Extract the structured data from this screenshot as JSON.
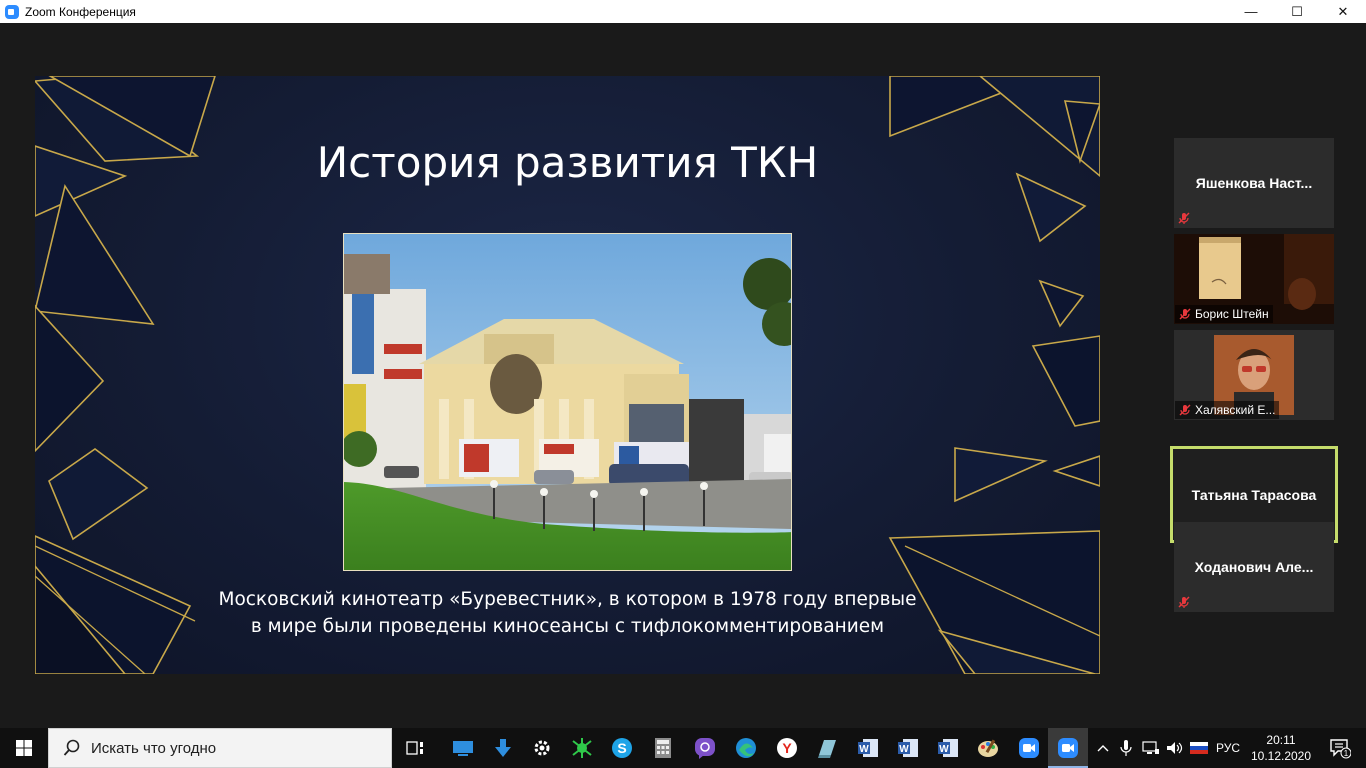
{
  "window": {
    "title": "Zoom Конференция",
    "controls": {
      "minimize": "—",
      "maximize": "☐",
      "close": "✕"
    }
  },
  "slide": {
    "title": "История развития ТКН",
    "caption_line1": "Московский кинотеатр «Буревестник», в котором в 1978 году впервые",
    "caption_line2": "в мире были проведены киносеансы с тифлокомментированием"
  },
  "participants": [
    {
      "name": "Яшенкова  Наст...",
      "muted": true,
      "video": false
    },
    {
      "name": "Борис Штейн",
      "muted": true,
      "video": true
    },
    {
      "name": "Халявский Е...",
      "muted": true,
      "video": true
    },
    {
      "name": "Татьяна Тарасова",
      "muted": false,
      "video": false,
      "active_speaker": true
    },
    {
      "name": "Ходанович  Але...",
      "muted": true,
      "video": false
    }
  ],
  "taskbar": {
    "search_placeholder": "Искать что угодно",
    "icons": [
      "task-view-icon",
      "monitor-app-icon",
      "download-icon",
      "settings-icon",
      "spider-icon",
      "skype-icon",
      "calculator-icon",
      "viber-icon",
      "edge-icon",
      "yandex-icon",
      "book-app-icon",
      "word-icon",
      "word-icon",
      "word-icon",
      "paint-icon",
      "zoom-icon",
      "zoom-icon"
    ],
    "language": "РУС",
    "time": "20:11",
    "date": "10.12.2020",
    "notification_count": "1"
  },
  "colors": {
    "active_speaker_border": "#c5dc6b",
    "muted_mic": "#e8383d",
    "zoom_blue": "#2d8cff",
    "slide_gold": "#c8a84a"
  }
}
